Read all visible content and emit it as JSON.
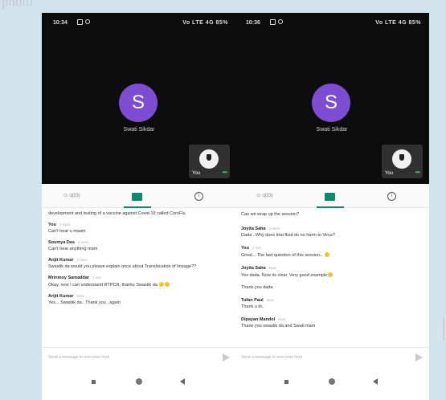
{
  "caption": "photo",
  "screens": [
    {
      "status": {
        "time": "10:34",
        "right": "Vo LTE 4G 85%"
      },
      "participant": {
        "initial": "S",
        "name": "Swati Sikdar"
      },
      "self": {
        "label": "You",
        "more": "•••"
      },
      "tabs": {
        "people_count": "(33)",
        "info": "i"
      },
      "messages": [
        {
          "plain": "development and testing of a vaccine against Covid-19 called CoroFlu."
        },
        {
          "sender": "You",
          "time": "3 mins",
          "text": "Can't hear u maam"
        },
        {
          "sender": "Soumya Das",
          "time": "3 mins",
          "text": "Can't hear anything mam"
        },
        {
          "sender": "Arijit Kumar",
          "time": "2 mins",
          "text": "Swastik da would you please explain once about Translocation of lineage??"
        },
        {
          "sender": "Mrinmoy Samaddar",
          "time": "1 min",
          "text": "Okay, now I can understand RTPCR, thanks Swastik da."
        },
        {
          "sender": "Arijit Kumar",
          "time": "Now",
          "text": "Yes... Swastik da.. Thank you ..again"
        }
      ],
      "input_placeholder": "Send a message to everyone here"
    },
    {
      "status": {
        "time": "10:36",
        "right": "Vo LTE 4G 85%"
      },
      "participant": {
        "initial": "S",
        "name": "Swati Sikdar"
      },
      "self": {
        "label": "You",
        "more": "•••"
      },
      "tabs": {
        "people_count": "(33)",
        "info": "i"
      },
      "messages": [
        {
          "plain": "Can we wrap up the session?"
        },
        {
          "sender": "Joyita Saha",
          "time": "2 mins",
          "text": "Dada ..Why does that fluid do no harm to Virus?"
        },
        {
          "sender": "You",
          "time": "1 min",
          "text": "Great... The last question of this session..."
        },
        {
          "sender": "Joyita Saha",
          "time": "Now",
          "text": "Yes dada. Now its clear. Very good example"
        },
        {
          "plain": "Thank you dada"
        },
        {
          "sender": "Tufan Paul",
          "time": "Now",
          "text": "Thank u di.."
        },
        {
          "sender": "Dipayan Mandol",
          "time": "Now",
          "text": "Thank you swastik da and Swati mam"
        }
      ],
      "input_placeholder": "Send a message to everyone here"
    }
  ]
}
